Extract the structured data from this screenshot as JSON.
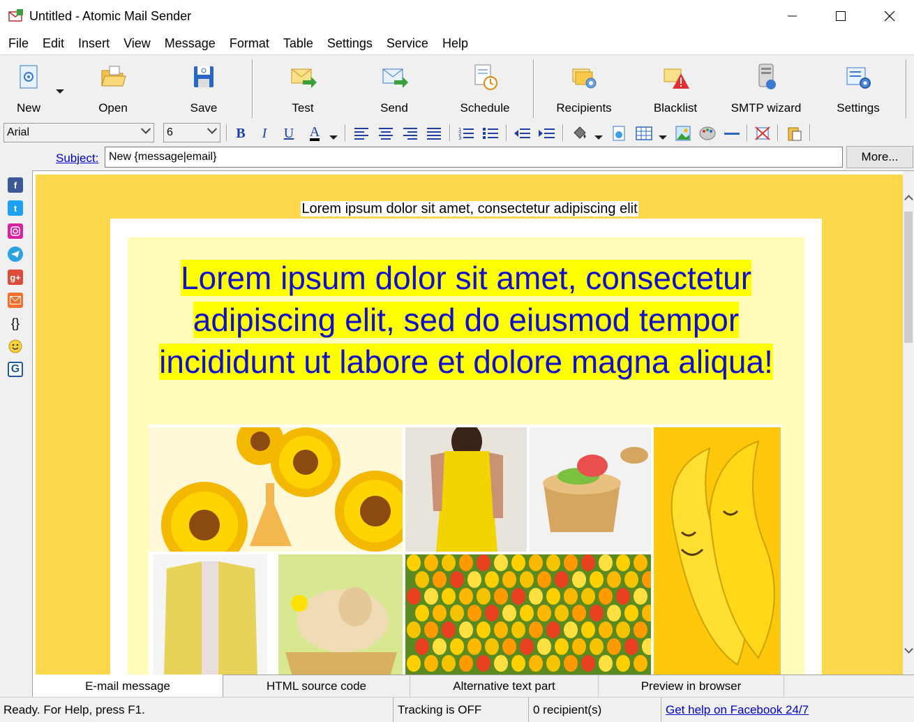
{
  "window": {
    "title": "Untitled - Atomic Mail Sender"
  },
  "menu": [
    "File",
    "Edit",
    "Insert",
    "View",
    "Message",
    "Format",
    "Table",
    "Settings",
    "Service",
    "Help"
  ],
  "toolbar": {
    "new": "New",
    "open": "Open",
    "save": "Save",
    "test": "Test",
    "send": "Send",
    "schedule": "Schedule",
    "recipients": "Recipients",
    "blacklist": "Blacklist",
    "smtp_wizard": "SMTP wizard",
    "settings": "Settings"
  },
  "format": {
    "font": "Arial",
    "size": "6",
    "bold": "B",
    "italic": "I",
    "underline": "U",
    "font_color": "A"
  },
  "subject": {
    "label": "Subject:",
    "value": "New {message|email}",
    "more": "More..."
  },
  "sidebar_icons": [
    "facebook-icon",
    "twitter-icon",
    "instagram-icon",
    "telegram-icon",
    "google-plus-icon",
    "email-icon",
    "braces-icon",
    "smiley-icon",
    "grammar-icon"
  ],
  "editor": {
    "pre_header": "Lorem ipsum dolor sit amet, consectetur adipiscing elit",
    "headline": "Lorem ipsum dolor sit amet, consectetur adipiscing elit, sed do eiusmod tempor incididunt ut labore et dolore magna aliqua!",
    "background_color": "#fdd84d",
    "highlight_color": "#ffff00",
    "headline_color": "#1010cc"
  },
  "tabs": [
    "E-mail message",
    "HTML source code",
    "Alternative text part",
    "Preview in browser"
  ],
  "status": {
    "ready": "Ready. For Help, press F1.",
    "tracking": "Tracking is OFF",
    "recipients": "0 recipient(s)",
    "help_link": "Get help on Facebook 24/7"
  }
}
